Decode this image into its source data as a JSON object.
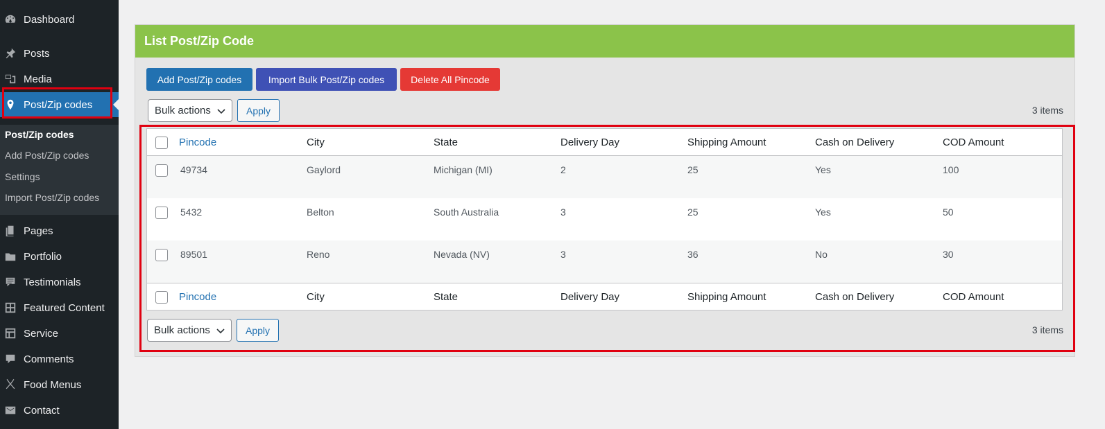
{
  "sidebar": {
    "items": [
      {
        "label": "Dashboard",
        "icon": "dashboard-icon"
      },
      {
        "label": "Posts",
        "icon": "pin-icon"
      },
      {
        "label": "Media",
        "icon": "media-icon"
      },
      {
        "label": "Post/Zip codes",
        "icon": "location-icon"
      },
      {
        "label": "Pages",
        "icon": "pages-icon"
      },
      {
        "label": "Portfolio",
        "icon": "folder-icon"
      },
      {
        "label": "Testimonials",
        "icon": "testimonial-icon"
      },
      {
        "label": "Featured Content",
        "icon": "grid-icon"
      },
      {
        "label": "Service",
        "icon": "layout-icon"
      },
      {
        "label": "Comments",
        "icon": "comment-icon"
      },
      {
        "label": "Food Menus",
        "icon": "food-icon"
      },
      {
        "label": "Contact",
        "icon": "mail-icon"
      }
    ],
    "submenu": [
      {
        "label": "Post/Zip codes"
      },
      {
        "label": "Add Post/Zip codes"
      },
      {
        "label": "Settings"
      },
      {
        "label": "Import Post/Zip codes"
      }
    ],
    "colors": {
      "background": "#1d2327",
      "active": "#2271b1",
      "highlight": "#e00010"
    }
  },
  "panel": {
    "title": "List Post/Zip Code",
    "header_color": "#8bc34a",
    "buttons": {
      "add": "Add Post/Zip codes",
      "import": "Import Bulk Post/Zip codes",
      "delete": "Delete All Pincode"
    },
    "bulk_actions": "Bulk actions",
    "apply": "Apply",
    "items_count": "3 items"
  },
  "table": {
    "columns": [
      "Pincode",
      "City",
      "State",
      "Delivery Day",
      "Shipping Amount",
      "Cash on Delivery",
      "COD Amount"
    ],
    "rows": [
      [
        "49734",
        "Gaylord",
        "Michigan (MI)",
        "2",
        "25",
        "Yes",
        "100"
      ],
      [
        "5432",
        "Belton",
        "South Australia",
        "3",
        "25",
        "Yes",
        "50"
      ],
      [
        "89501",
        "Reno",
        "Nevada (NV)",
        "3",
        "36",
        "No",
        "30"
      ]
    ]
  }
}
